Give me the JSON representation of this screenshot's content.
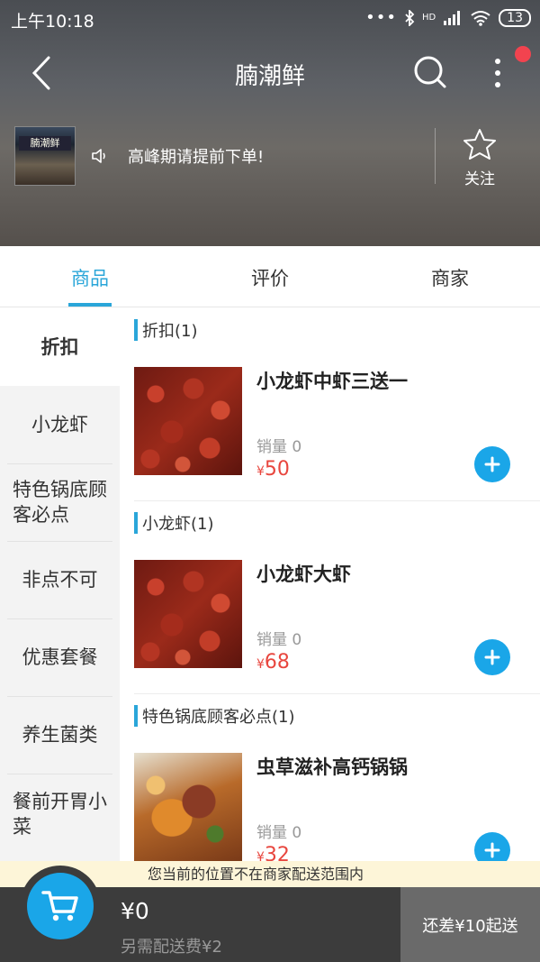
{
  "status": {
    "time": "上午10:18",
    "network": "HD",
    "battery": "13"
  },
  "header": {
    "title": "腩潮鲜",
    "shop_sign": "腩潮鲜",
    "notice": "高峰期请提前下单!",
    "follow_label": "关注",
    "has_notification": true
  },
  "tabs": [
    {
      "label": "商品",
      "active": true
    },
    {
      "label": "评价",
      "active": false
    },
    {
      "label": "商家",
      "active": false
    }
  ],
  "sidebar": {
    "items": [
      {
        "label": "折扣",
        "active": true
      },
      {
        "label": "小龙虾",
        "active": false
      },
      {
        "label": "特色锅底顾客必点",
        "active": false
      },
      {
        "label": "非点不可",
        "active": false
      },
      {
        "label": "优惠套餐",
        "active": false
      },
      {
        "label": "养生菌类",
        "active": false
      },
      {
        "label": "餐前开胃小菜",
        "active": false
      }
    ]
  },
  "sections": [
    {
      "title": "折扣(1)",
      "products": [
        {
          "name": "小龙虾中虾三送一",
          "sales": "销量 0",
          "currency": "¥",
          "price": "50",
          "image": "crawfish-photo"
        }
      ]
    },
    {
      "title": "小龙虾(1)",
      "products": [
        {
          "name": "小龙虾大虾",
          "sales": "销量 0",
          "currency": "¥",
          "price": "68",
          "image": "crawfish-photo"
        }
      ]
    },
    {
      "title": "特色锅底顾客必点(1)",
      "products": [
        {
          "name": "虫草滋补高钙锅锅",
          "sales": "销量 0",
          "currency": "¥",
          "price": "32",
          "image": "soup-photo"
        }
      ]
    }
  ],
  "warning": "您当前的位置不在商家配送范围内",
  "cart": {
    "total": "¥0",
    "delivery_fee": "另需配送费¥2",
    "checkout_label": "还差¥10起送"
  },
  "colors": {
    "accent": "#2aa6d9",
    "add_button": "#1aa6e8",
    "price": "#e8463e",
    "notification_dot": "#f2434f"
  }
}
